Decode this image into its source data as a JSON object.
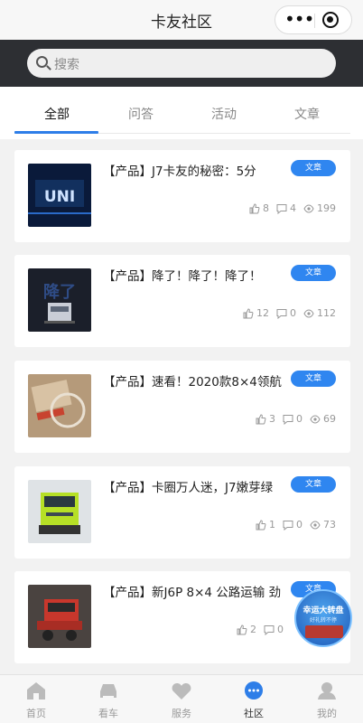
{
  "window": {
    "title": "卡友社区"
  },
  "search": {
    "placeholder": "搜索"
  },
  "tabs": [
    "全部",
    "问答",
    "活动",
    "文章"
  ],
  "posts": [
    {
      "title": "【产品】J7卡友的秘密：5分",
      "badge": "文章",
      "likes": "8",
      "comments": "4",
      "views": "199",
      "thumb_icon": "uni-banner-image"
    },
    {
      "title": "【产品】降了！降了！降了！",
      "badge": "文章",
      "likes": "12",
      "comments": "0",
      "views": "112",
      "thumb_icon": "truck-dark-image"
    },
    {
      "title": "【产品】速看！2020款8×4领航",
      "badge": "文章",
      "likes": "3",
      "comments": "0",
      "views": "69",
      "thumb_icon": "magnifier-document-image"
    },
    {
      "title": "【产品】卡圈万人迷，J7嫩芽绿",
      "badge": "文章",
      "likes": "1",
      "comments": "0",
      "views": "73",
      "thumb_icon": "green-truck-image"
    },
    {
      "title": "【产品】新J6P 8×4 公路运输 劲",
      "badge": "文章",
      "likes": "2",
      "comments": "0",
      "views": "",
      "thumb_icon": "red-truck-image"
    }
  ],
  "floating": {
    "line1": "幸运大转盘",
    "line2": "好礼转不停"
  },
  "nav": [
    {
      "label": "首页",
      "icon": "home-icon"
    },
    {
      "label": "看车",
      "icon": "car-icon"
    },
    {
      "label": "服务",
      "icon": "heart-icon"
    },
    {
      "label": "社区",
      "icon": "chat-icon"
    },
    {
      "label": "我的",
      "icon": "user-icon"
    }
  ],
  "colors": {
    "accent": "#2e7ee8",
    "badge": "#2f86f0",
    "searchbar": "#2d2f33"
  }
}
